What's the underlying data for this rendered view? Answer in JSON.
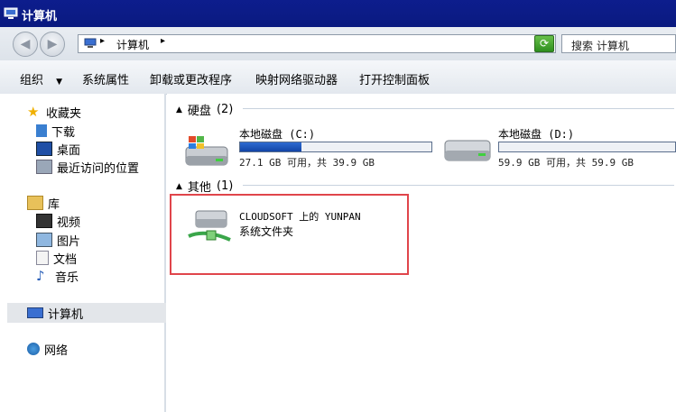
{
  "window": {
    "title": "计算机"
  },
  "address": {
    "crumb": "计算机",
    "search_placeholder": "搜索 计算机"
  },
  "toolbar": {
    "organize": "组织",
    "system_properties": "系统属性",
    "uninstall": "卸载或更改程序",
    "map_drive": "映射网络驱动器",
    "control_panel": "打开控制面板"
  },
  "sidebar": {
    "favorites": "收藏夹",
    "downloads": "下载",
    "desktop": "桌面",
    "recent": "最近访问的位置",
    "libraries": "库",
    "videos": "视频",
    "pictures": "图片",
    "documents": "文档",
    "music": "音乐",
    "computer": "计算机",
    "network": "网络"
  },
  "groups": {
    "hard_disks": {
      "label": "硬盘",
      "count": "(2)"
    },
    "other": {
      "label": "其他",
      "count": "(1)"
    }
  },
  "drives": [
    {
      "name": "本地磁盘 (C:)",
      "info": "27.1 GB 可用，共 39.9 GB",
      "used_fraction": 0.32
    },
    {
      "name": "本地磁盘 (D:)",
      "info": "59.9 GB 可用，共 59.9 GB",
      "used_fraction": 0.0
    }
  ],
  "other_items": [
    {
      "name": "CLOUDSOFT 上的 YUNPAN",
      "type": "系统文件夹"
    }
  ],
  "colors": {
    "titlebar": "#0d1d8d",
    "drive_fill": "#1f55bd",
    "highlight": "#e0454b"
  }
}
